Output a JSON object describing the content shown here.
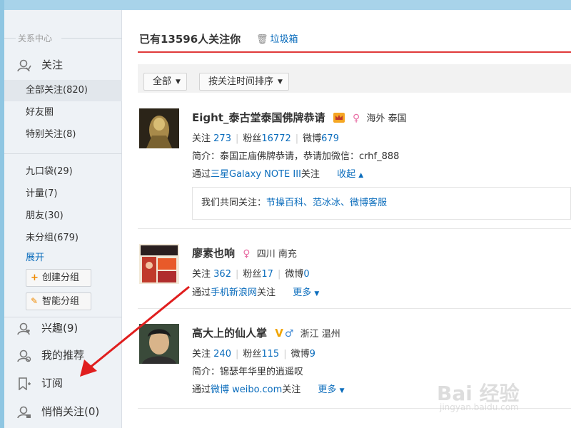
{
  "sidebar": {
    "section_title": "关系中心",
    "follow_label": "关注",
    "all_follow": "全部关注(820)",
    "friends": "好友圈",
    "special": "特别关注(8)",
    "groups": [
      "九口袋(29)",
      "计量(7)",
      "朋友(30)",
      "未分组(679)"
    ],
    "expand": "展开",
    "create_group": "创建分组",
    "smart_group": "智能分组",
    "interest": "兴趣(9)",
    "recommend": "我的推荐",
    "subscribe": "订阅",
    "secret_follow": "悄悄关注(0)"
  },
  "main": {
    "title": "已有13596人关注你",
    "trash": "垃圾箱",
    "filter_all": "全部",
    "filter_sort": "按关注时间排序"
  },
  "users": [
    {
      "name": "Eight_泰古堂泰国佛牌恭请",
      "location": "海外 泰国",
      "gender": "♀",
      "follow_label": "关注",
      "follow": "273",
      "fans_label": "粉丝",
      "fans": "16772",
      "weibo_label": "微博",
      "weibo": "679",
      "intro": "简介：泰国正庙佛牌恭请，恭请加微信：crhf_888",
      "via_prefix": "通过",
      "via_source": "三星Galaxy NOTE III",
      "via_suffix": "关注",
      "more": "收起",
      "common_label": "我们共同关注：",
      "common": [
        "节操百科",
        "范冰冰",
        "微博客服"
      ]
    },
    {
      "name": "廖素也响",
      "location": "四川 南充",
      "gender": "♀",
      "follow_label": "关注",
      "follow": "362",
      "fans_label": "粉丝",
      "fans": "17",
      "weibo_label": "微博",
      "weibo": "0",
      "via_prefix": "通过",
      "via_source": "手机新浪网",
      "via_suffix": "关注",
      "more": "更多"
    },
    {
      "name": "高大上的仙人掌",
      "location": "浙江 温州",
      "verified": "V",
      "gender": "♂",
      "follow_label": "关注",
      "follow": "240",
      "fans_label": "粉丝",
      "fans": "115",
      "weibo_label": "微博",
      "weibo": "9",
      "intro": "简介：锦瑟年华里的逍遥叹",
      "via_prefix": "通过",
      "via_source": "微博 weibo.com",
      "via_suffix": "关注",
      "more": "更多"
    }
  ],
  "watermark": {
    "brand": "Bai 经验",
    "url": "jingyan.baidu.com"
  },
  "colors": {
    "link": "#0a6cbc",
    "accent_red": "#e03a3a",
    "annotation_arrow": "#e01e1e"
  }
}
